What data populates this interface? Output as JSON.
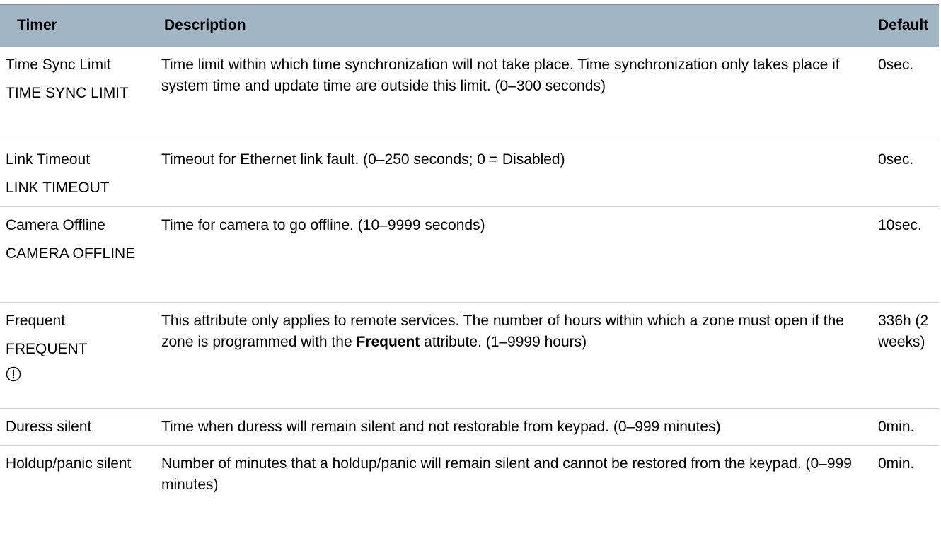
{
  "header": {
    "timer": "Timer",
    "description": "Description",
    "default": "Default"
  },
  "rows": [
    {
      "label": "Time Sync Limit",
      "menu": "TIME SYNC LIMIT",
      "description": "Time limit within which time synchronization will not take place. Time synchronization only takes place if system time and update time are outside this limit. (0–300 seconds)",
      "default": "0sec."
    },
    {
      "label": "Link Timeout",
      "menu": "LINK TIMEOUT",
      "description": "Timeout for Ethernet link fault. (0–250 seconds; 0 = Disabled)",
      "default": "0sec."
    },
    {
      "label": "Camera Offline",
      "menu": "CAMERA OFFLINE",
      "description": "Time for camera to go offline. (10–9999 seconds)",
      "default": "10sec."
    },
    {
      "label": "Frequent",
      "menu": "FREQUENT",
      "icon": "warning-icon",
      "description_before": "This attribute only applies to remote services. The number of hours within which a zone must open if the zone is programmed with the ",
      "description_bold": "Frequent",
      "description_after": " attribute. (1–9999 hours)",
      "default": "336h (2 weeks)"
    },
    {
      "label": "Duress silent",
      "description": "Time when duress will remain silent and not restorable from keypad. (0–999 minutes)",
      "default": "0min."
    },
    {
      "label": "Holdup/panic silent",
      "description": "Number of minutes that a holdup/panic will remain silent and cannot be restored from the keypad. (0–999 minutes)",
      "default": "0min."
    }
  ],
  "colors": {
    "header_background": "#a2b5c5",
    "row_divider": "#c4d0da"
  }
}
